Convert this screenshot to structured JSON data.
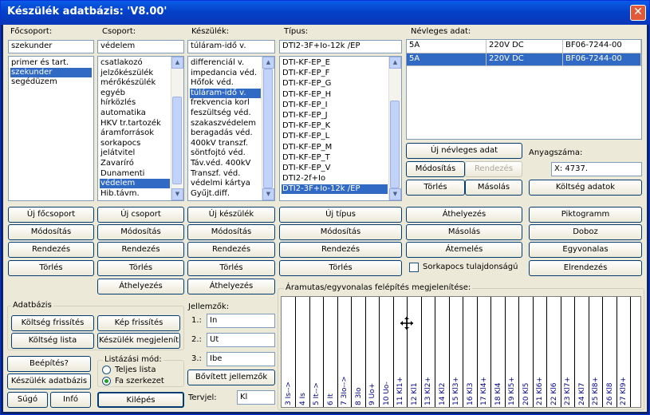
{
  "title": "Készülék adatbázis: 'V8.00'",
  "close_label": "✕",
  "focsoport": {
    "label": "Főcsoport:",
    "value": "szekunder",
    "items": [
      "primer és tart.",
      "szekunder",
      "segédüzem"
    ],
    "selected": 1,
    "btn_new": "Új főcsoport",
    "btn_modify": "Módosítás",
    "btn_sort": "Rendezés",
    "btn_delete": "Törlés"
  },
  "csoport": {
    "label": "Csoport:",
    "value": "védelem",
    "items": [
      "csatlakozó",
      "jelzőkészülék",
      "mérőkészülék",
      "egyéb",
      "hírközlés",
      "automatika",
      "HKV tr.tartozék",
      "áramforrások",
      "sorkapocs",
      "jelátvitel",
      "Zavaríró",
      "Dunamenti",
      "védelem",
      "Hib.távm."
    ],
    "selected": 12,
    "btn_new": "Új csoport",
    "btn_modify": "Módosítás",
    "btn_sort": "Rendezés",
    "btn_delete": "Törlés",
    "btn_move": "Áthelyezés"
  },
  "keszulek": {
    "label": "Készülék:",
    "value": "túláram-idő v.",
    "items": [
      "differenciál v.",
      "impedancia véd.",
      "Hőfok véd.",
      "túláram-idő v.",
      "frekvencia korl",
      "feszültség véd.",
      "szakaszvédelem",
      "beragadás véd.",
      "400kV transzf.",
      "söntfojtó véd.",
      "Táv.véd. 400kV",
      "Transzf. véd.",
      "védelmi kártya",
      "Gyűjt.diff."
    ],
    "selected": 3,
    "btn_new": "Új készülék",
    "btn_modify": "Módosítás",
    "btn_sort": "Rendezés",
    "btn_delete": "Törlés",
    "btn_move": "Áthelyezés"
  },
  "tipus": {
    "label": "Típus:",
    "value": "DTI2-3F+Io-12k /EP",
    "items": [
      "DTI-KF-EP_E",
      "DTI-KF-EP_F",
      "DTI-KF-EP_G",
      "DTI-KF-EP_H",
      "DTI-KF-EP_I",
      "DTI-KF-EP_J",
      "DTI-KF-EP_K",
      "DTI-KF-EP_L",
      "DTI-KF-EP_M",
      "DTI-KF-EP_T",
      "DTI-KF-EP_V",
      "DTI2-2f+Io",
      "DTI2-3F+Io-12k /EP"
    ],
    "selected": 12,
    "btn_new": "Új típus",
    "btn_modify": "Módosítás",
    "btn_sort": "Rendezés",
    "btn_delete": "Törlés"
  },
  "nevleges": {
    "label": "Névleges adat:",
    "header": [
      "5A",
      "220V DC",
      "BF06-7244-00"
    ],
    "rows": [
      [
        "5A",
        "220V DC",
        "BF06-7244-00"
      ]
    ],
    "btn_new": "Új névleges adat",
    "btn_modify": "Módosítás",
    "btn_sort": "Rendezés",
    "btn_delete": "Törlés",
    "btn_copy": "Másolás",
    "btn_cost": "Költség adatok",
    "anyagszam_label": "Anyagszáma:",
    "anyagszam_value": "X: 4737."
  },
  "actions": {
    "athelyezes": "Áthelyezés",
    "masolas": "Másolás",
    "atemeles": "Átemelés",
    "sorkapocs_label": "Sorkapocs tulajdonságú",
    "piktogramm": "Piktogramm",
    "doboz": "Doboz",
    "egyvonalas": "Egyvonalas",
    "elrendezes": "Elrendezés"
  },
  "adatbazis": {
    "label": "Adatbázis",
    "koltseg_frissites": "Költség frissítés",
    "kep_frissites": "Kép frissítés",
    "koltseg_lista": "Költség lista",
    "keszulek_megjelenit": "Készülék megjelenít"
  },
  "jellemzok": {
    "label": "Jellemzők:",
    "rows": [
      {
        "n": "1.:",
        "v": "In"
      },
      {
        "n": "2.:",
        "v": "Ut"
      },
      {
        "n": "3.:",
        "v": "Ibe"
      }
    ],
    "btn_extended": "Bővített jellemzők",
    "tervjel_label": "Tervjel:",
    "tervjel_value": "Kl"
  },
  "listazasi": {
    "label": "Listázási mód:",
    "opt1": "Teljes lista",
    "opt2": "Fa szerkezet",
    "selected": 2
  },
  "bottom": {
    "beepites": "Beépítés?",
    "keszulek_adatbazis": "Készülék adatbázis",
    "sugo": "Súgó",
    "info": "Infó",
    "kilepes": "Kilépés"
  },
  "diagram": {
    "label": "Áramutas/egyvonalas felépítés megjelenítése:",
    "columns": [
      "3 Is-->",
      "4 Is",
      "5 It-->",
      "6 It",
      "7 3Io-->",
      "8 3Io",
      "9 Uo+",
      "10 Uo-",
      "11 Kl1+",
      "12 Kl1",
      "13 Kl2+",
      "14 Kl2",
      "15 Kl3+",
      "16 Kl3",
      "17 Kl4+",
      "18 Kl4",
      "19 Kl5+",
      "20 Kl5",
      "21 Kl6+",
      "22 Kl6",
      "23 Kl7+",
      "24 Kl7",
      "25 Kl8+",
      "26 Kl8",
      "27 Kl9+"
    ]
  }
}
